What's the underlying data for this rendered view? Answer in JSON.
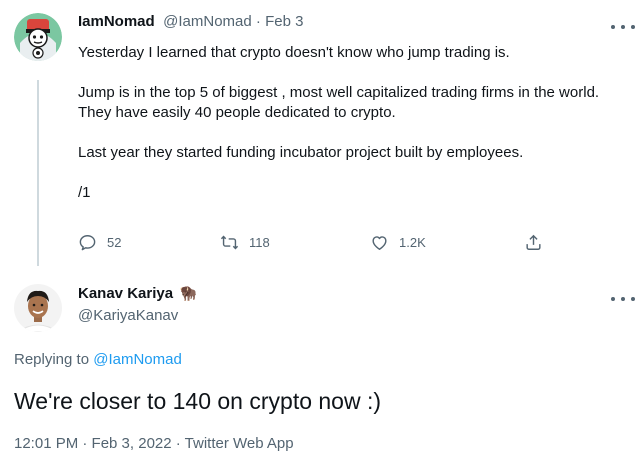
{
  "tweet1": {
    "display_name": "IamNomad",
    "handle": "@IamNomad",
    "separator": " · ",
    "date": "Feb 3",
    "text": "Yesterday I learned that crypto doesn't know who jump trading is.\n\nJump is in the top 5 of biggest , most well capitalized trading firms in the world. They have easily 40 people dedicated to crypto.\n\nLast year they started funding incubator project built by employees.\n\n/1",
    "actions": {
      "replies": "52",
      "retweets": "118",
      "likes": "1.2K"
    }
  },
  "tweet2": {
    "display_name": "Kanav Kariya",
    "badge_emoji": "🦬",
    "handle": "@KariyaKanav",
    "replying_prefix": "Replying to ",
    "replying_handle": "@IamNomad",
    "text": "We're closer to 140 on crypto now :)",
    "timestamp": "12:01 PM · Feb 3, 2022 · Twitter Web App"
  },
  "icons": {
    "reply": "reply-icon",
    "retweet": "retweet-icon",
    "like": "heart-icon",
    "share": "share-icon",
    "more": "more-icon"
  },
  "colors": {
    "text": "#0f1419",
    "muted": "#536471",
    "link": "#1d9bf0",
    "thread_line": "#cfd9de"
  }
}
